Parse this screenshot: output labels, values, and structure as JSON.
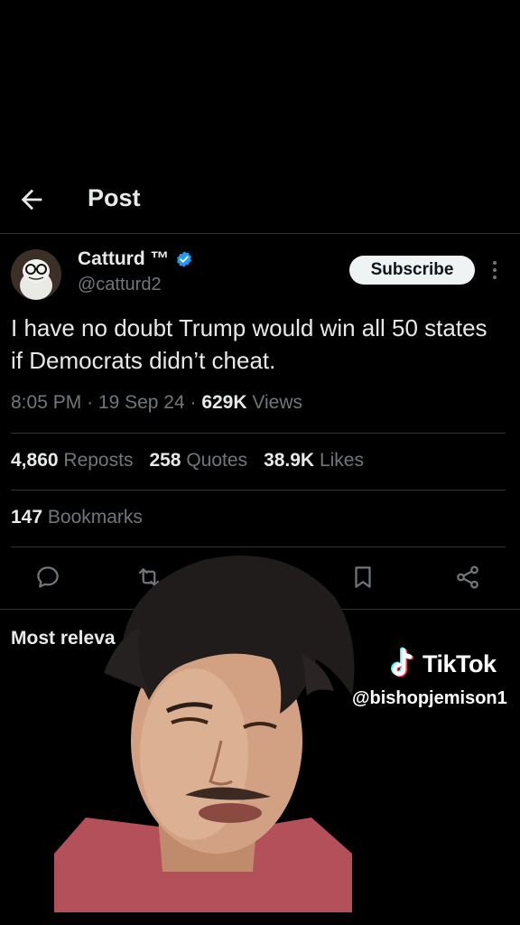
{
  "header": {
    "title": "Post"
  },
  "author": {
    "name": "Catturd ™",
    "handle": "@catturd2"
  },
  "actions": {
    "subscribe_label": "Subscribe"
  },
  "tweet": {
    "text": "I have no doubt Trump would win all 50 states if Democrats didn’t cheat.",
    "time": "8:05 PM",
    "date": "19 Sep 24",
    "views_count": "629K",
    "views_label": "Views"
  },
  "stats": {
    "reposts_count": "4,860",
    "reposts_label": "Reposts",
    "quotes_count": "258",
    "quotes_label": "Quotes",
    "likes_count": "38.9K",
    "likes_label": "Likes",
    "bookmarks_count": "147",
    "bookmarks_label": "Bookmarks"
  },
  "replies": {
    "sort_label": "Most releva"
  },
  "watermark": {
    "brand": "TikTok",
    "handle": "@bishopjemison1"
  },
  "icons": {
    "back": "arrow-left-icon",
    "verified": "verified-badge-icon",
    "more": "more-vertical-icon",
    "reply": "reply-icon",
    "repost": "repost-icon",
    "bookmark": "bookmark-icon",
    "share": "share-icon"
  },
  "colors": {
    "background": "#000000",
    "verified": "#1d9bf0",
    "muted": "#71767b",
    "text": "#e7e9ea"
  }
}
